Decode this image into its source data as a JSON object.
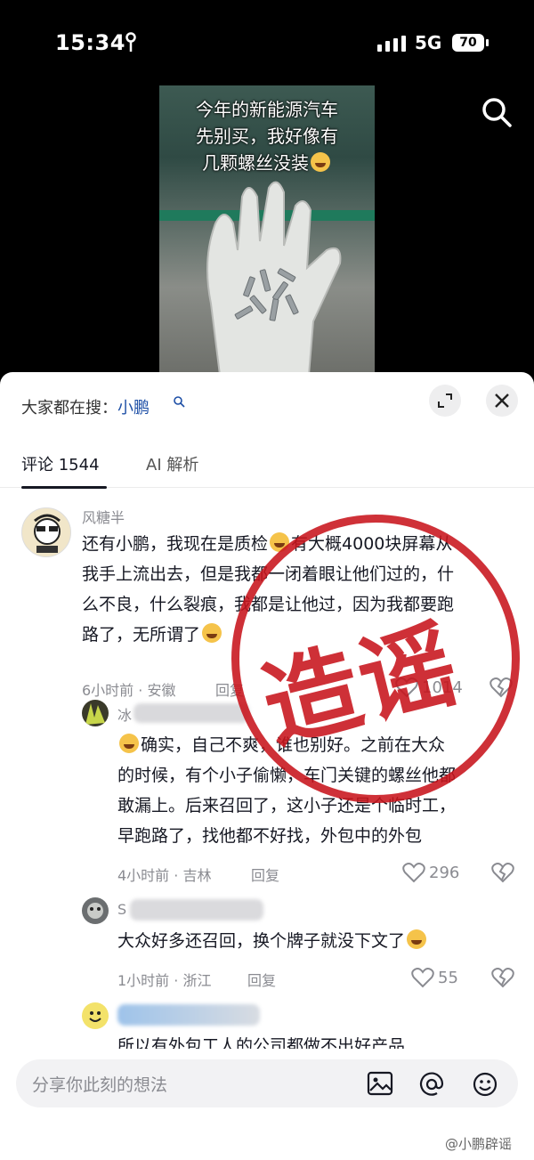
{
  "status_bar": {
    "time": "15:34",
    "network": "5G",
    "battery": "70"
  },
  "video": {
    "caption": [
      "今年的新能源汽车",
      "先别买，我好像有",
      "几颗螺丝没装"
    ]
  },
  "panel": {
    "hot_search_label": "大家都在搜：",
    "hot_search_link": "小鹏",
    "tabs": [
      {
        "label": "评论 1544"
      },
      {
        "label": "AI 解析"
      }
    ]
  },
  "comments": [
    {
      "username": "风糖半",
      "lines": [
        "还有小鹏，我现在是质检",
        "有大概4000块屏幕从",
        "我手上流出去，但是我都一闭着眼让他们过的，什",
        "么不良，什么裂痕，我都是让他过，因为我都要跑",
        "路了，无所谓了"
      ],
      "meta": "6小时前 · 安徽",
      "reply_label": "回复",
      "likes": "1014"
    },
    {
      "username": "冰",
      "lines": [
        "确实，自己不爽，谁也别好。之前在大众",
        "的时候，有个小子偷懒，车门关键的螺丝他都",
        "敢漏上。后来召回了，这小子还是个临时工，",
        "早跑路了，找他都不好找，外包中的外包"
      ],
      "meta": "4小时前 · 吉林",
      "reply_label": "回复",
      "likes": "296"
    },
    {
      "username": "S",
      "lines": [
        "大众好多还召回，换个牌子就没下文了"
      ],
      "meta": "1小时前 · 浙江",
      "reply_label": "回复",
      "likes": "55"
    },
    {
      "username": "",
      "lines": [
        "所以有外包工人的公司都做不出好产品"
      ]
    }
  ],
  "stamp_text": "造谣",
  "input_bar": {
    "placeholder": "分享你此刻的想法"
  },
  "watermark": "@小鹏辟谣",
  "colors": {
    "stamp_red": "#c8141c",
    "link_blue": "#1d4fa6",
    "meta_gray": "#8a8b91"
  }
}
